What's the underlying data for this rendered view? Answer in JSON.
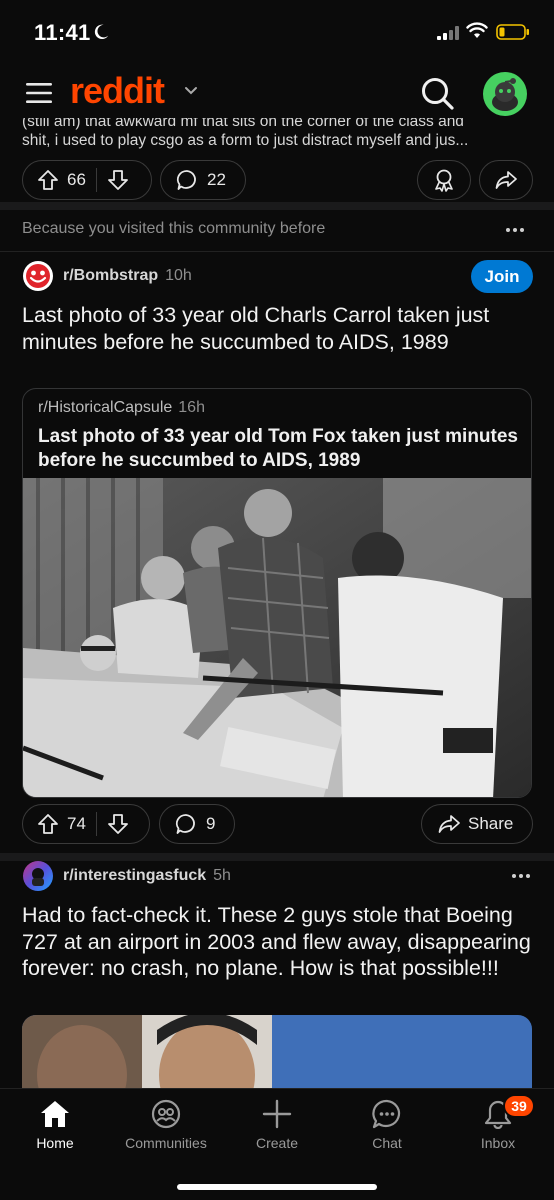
{
  "status_bar": {
    "time": "11:41"
  },
  "header": {
    "brand": "reddit"
  },
  "prev_post": {
    "text_line1": "(still am) that awkward mf that sits on the corner of the class and",
    "text_line2": "shit, i used to play csgo as a form to just distract myself and jus...",
    "upvotes": "66",
    "comments": "22"
  },
  "recommendation_reason": "Because you visited this community before",
  "post1": {
    "subreddit": "r/Bombstrap",
    "time": "10h",
    "join_label": "Join",
    "title": "Last photo of 33 year old Charls Carrol taken just minutes before he succumbed to AIDS, 1989",
    "crosspost": {
      "subreddit": "r/HistoricalCapsule",
      "time": "16h",
      "title": "Last photo of 33 year old Tom Fox taken just minutes before he succumbed to AIDS, 1989"
    },
    "upvotes": "74",
    "comments": "9",
    "share_label": "Share"
  },
  "post2": {
    "subreddit": "r/interestingasfuck",
    "time": "5h",
    "title": "Had to fact-check it. These 2 guys stole that Boeing 727 at an airport in 2003 and flew away, disappearing forever: no crash, no plane. How is that possible!!!"
  },
  "bottom_nav": {
    "items": [
      {
        "label": "Home",
        "icon": "home-icon",
        "active": true
      },
      {
        "label": "Communities",
        "icon": "communities-icon"
      },
      {
        "label": "Create",
        "icon": "plus-icon"
      },
      {
        "label": "Chat",
        "icon": "chat-icon"
      },
      {
        "label": "Inbox",
        "icon": "bell-icon"
      }
    ],
    "inbox_badge": "39"
  },
  "colors": {
    "brand": "#ff4500",
    "join": "#0079d3",
    "background": "#0b0b0b",
    "badge": "#ff4500"
  }
}
